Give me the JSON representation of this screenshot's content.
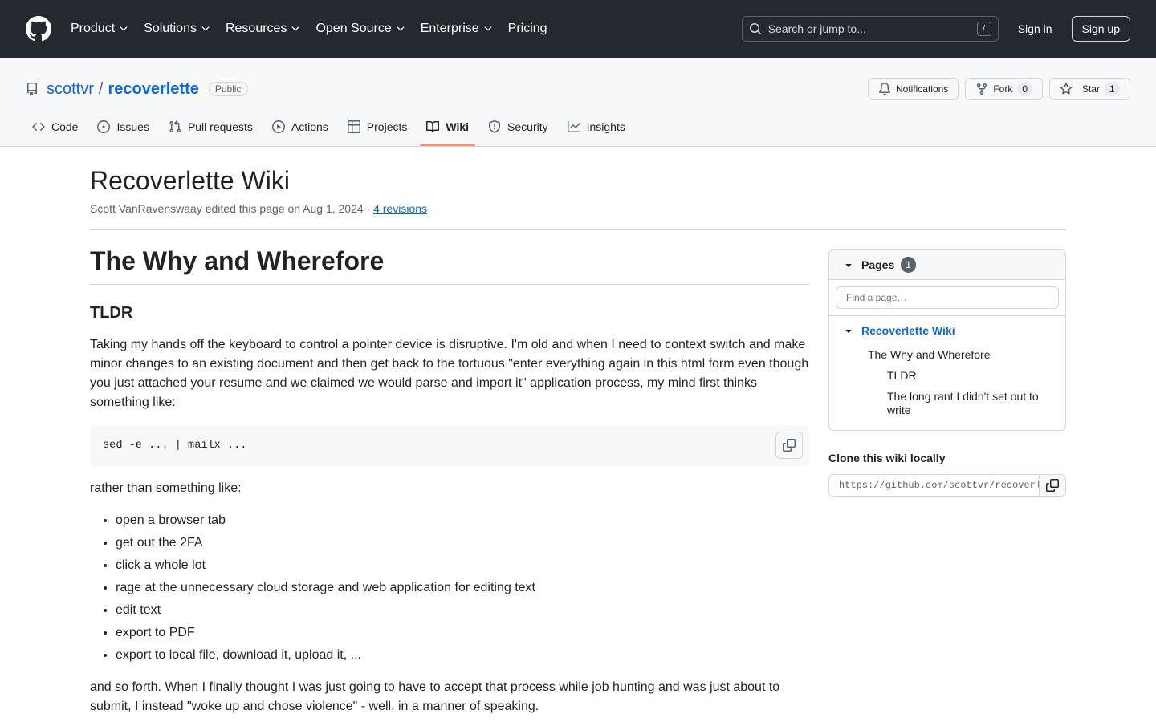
{
  "header": {
    "nav": [
      {
        "label": "Product",
        "dropdown": true
      },
      {
        "label": "Solutions",
        "dropdown": true
      },
      {
        "label": "Resources",
        "dropdown": true
      },
      {
        "label": "Open Source",
        "dropdown": true
      },
      {
        "label": "Enterprise",
        "dropdown": true
      },
      {
        "label": "Pricing",
        "dropdown": false
      }
    ],
    "search_placeholder": "Search or jump to...",
    "search_shortcut": "/",
    "signin": "Sign in",
    "signup": "Sign up"
  },
  "repo": {
    "owner": "scottvr",
    "separator": "/",
    "name": "recoverlette",
    "visibility": "Public",
    "notifications_label": "Notifications",
    "fork_label": "Fork",
    "fork_count": "0",
    "star_label": "Star",
    "star_count": "1",
    "tabs": [
      {
        "label": "Code",
        "icon": "code-icon"
      },
      {
        "label": "Issues",
        "icon": "issue-icon"
      },
      {
        "label": "Pull requests",
        "icon": "pull-request-icon"
      },
      {
        "label": "Actions",
        "icon": "play-icon"
      },
      {
        "label": "Projects",
        "icon": "table-icon"
      },
      {
        "label": "Wiki",
        "icon": "book-icon",
        "selected": true
      },
      {
        "label": "Security",
        "icon": "shield-icon"
      },
      {
        "label": "Insights",
        "icon": "graph-icon"
      }
    ]
  },
  "wiki": {
    "title": "Recoverlette Wiki",
    "meta_text": "Scott VanRavenswaay edited this page on Aug 1, 2024 · ",
    "revisions_link": "4 revisions"
  },
  "article": {
    "h1": "The Why and Wherefore",
    "h2": "TLDR",
    "para1": "Taking my hands off the keyboard to control a pointer device is disruptive. I'm old and when I need to context switch and make minor changes to an existing document and then get back to the tortuous \"enter everything again in this html form even though you just attached your resume and we claimed we would parse and import it\" application process, my mind first thinks something like:",
    "code": "sed -e ... | mailx ...",
    "para2": "rather than something like:",
    "list": [
      "open a browser tab",
      "get out the 2FA",
      "click a whole lot",
      "rage at the unnecessary cloud storage and web application for editing text",
      "edit text",
      "export to PDF",
      "export to local file, download it, upload it, ..."
    ],
    "para3": "and so forth. When I finally thought I was just going to have to accept that process while job hunting and was just about to submit, I instead \"woke up and chose violence\" - well, in a manner of speaking."
  },
  "sidebar": {
    "pages_label": "Pages",
    "pages_count": "1",
    "find_placeholder": "Find a page…",
    "tree_root": "Recoverlette Wiki",
    "tree_l1": "The Why and Wherefore",
    "tree_l2": [
      "TLDR",
      "The long rant I didn't set out to write"
    ],
    "clone_title": "Clone this wiki locally",
    "clone_url": "https://github.com/scottvr/recoverlette.wiki.git"
  }
}
